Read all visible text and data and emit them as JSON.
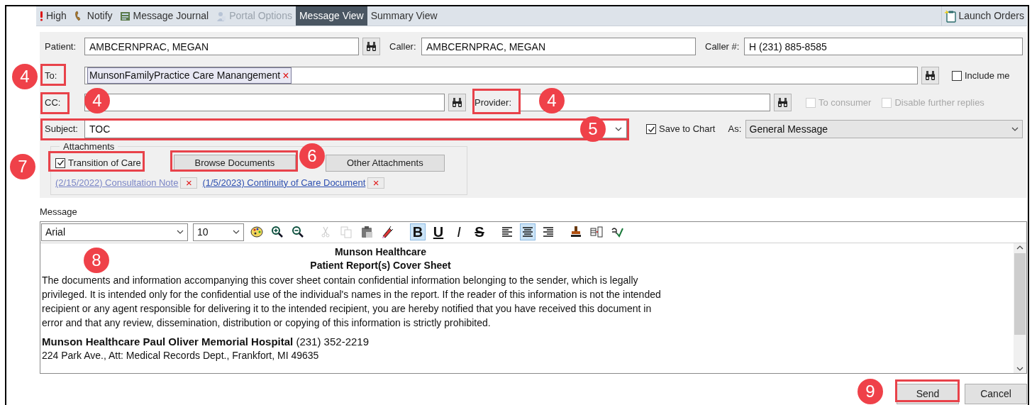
{
  "toolbar": {
    "items": [
      {
        "kind": "priority",
        "label": "High",
        "disabled": false,
        "selected": false
      },
      {
        "kind": "phone",
        "label": "Notify",
        "disabled": false,
        "selected": false
      },
      {
        "kind": "journal",
        "label": "Message Journal",
        "disabled": false,
        "selected": false
      },
      {
        "kind": "portal",
        "label": "Portal Options",
        "disabled": true,
        "selected": false
      },
      {
        "kind": "plain",
        "label": "Message View",
        "disabled": false,
        "selected": true
      },
      {
        "kind": "plain",
        "label": "Summary View",
        "disabled": false,
        "selected": false
      }
    ],
    "launch_orders": "Launch Orders"
  },
  "patient": {
    "label": "Patient:",
    "value": "AMBCERNPRAC, MEGAN"
  },
  "caller": {
    "label": "Caller:",
    "value": "AMBCERNPRAC, MEGAN"
  },
  "caller_number": {
    "label": "Caller #:",
    "value": "H (231) 885-8585"
  },
  "to": {
    "label": "To:",
    "recipients": [
      "MunsonFamilyPractice Care Manangement"
    ],
    "remove": "×"
  },
  "include_me": {
    "label": "Include me",
    "checked": false,
    "disabled": false
  },
  "cc": {
    "label": "CC:"
  },
  "provider": {
    "label": "Provider:"
  },
  "to_consumer": {
    "label": "To consumer",
    "checked": false,
    "disabled": true
  },
  "disable_replies": {
    "label": "Disable further replies",
    "checked": false,
    "disabled": true
  },
  "subject": {
    "label": "Subject:",
    "value": "TOC"
  },
  "save_to_chart": {
    "label": "Save to Chart",
    "checked": true,
    "disabled": false
  },
  "as": {
    "label": "As:",
    "value": "General Message"
  },
  "attachments": {
    "title": "Attachments",
    "transition_of_care": {
      "label": "Transition of Care",
      "checked": true,
      "disabled": false
    },
    "buttons": [
      "Browse Documents",
      "Other Attachments"
    ],
    "documents": [
      {
        "label": "(2/15/2022) Consultation Note",
        "visited": true,
        "remove": "×"
      },
      {
        "label": "(1/5/2023) Continuity of Care Document",
        "visited": false,
        "remove": "×"
      }
    ]
  },
  "message": {
    "label": "Message",
    "font": "Arial",
    "size": "10",
    "tools": [
      {
        "kind": "palette",
        "disabled": false,
        "selected": false
      },
      {
        "kind": "zoom-in",
        "disabled": false,
        "selected": false
      },
      {
        "kind": "zoom-out",
        "disabled": false,
        "selected": false
      },
      {
        "kind": "cut",
        "disabled": true,
        "selected": false
      },
      {
        "kind": "copy",
        "disabled": true,
        "selected": false
      },
      {
        "kind": "paste",
        "disabled": false,
        "selected": false
      },
      {
        "kind": "highlighter",
        "disabled": false,
        "selected": false
      },
      {
        "kind": "bold",
        "label": "B",
        "disabled": false,
        "selected": true
      },
      {
        "kind": "underline",
        "label": "U",
        "disabled": false,
        "selected": false
      },
      {
        "kind": "italic",
        "label": "I",
        "disabled": false,
        "selected": false
      },
      {
        "kind": "strike",
        "label": "S",
        "disabled": false,
        "selected": false
      },
      {
        "kind": "align-left",
        "disabled": false,
        "selected": false
      },
      {
        "kind": "align-center",
        "disabled": false,
        "selected": true
      },
      {
        "kind": "align-right",
        "disabled": false,
        "selected": false
      },
      {
        "kind": "stamp",
        "disabled": false,
        "selected": false
      },
      {
        "kind": "table",
        "disabled": false,
        "selected": false
      },
      {
        "kind": "spell",
        "disabled": false,
        "selected": false
      }
    ],
    "heading": [
      "Munson Healthcare",
      "Patient Report(s) Cover Sheet"
    ],
    "body": "The documents and information accompanying this cover sheet contain confidential information belonging to the sender, which is legally privileged.  It is intended only for the confidential use of the individual's names in the report.  If the reader of this information is not the intended recipient or any agent responsible for delivering it to the intended recipient, you are hereby notified that you have received this document in error and that any review, dissemination, distribution or copying of this information is strictly prohibited.",
    "hospital": "**Munson Healthcare Paul Oliver Memorial Hospital** (231) 352-2219",
    "address": "224 Park Ave., Att: Medical Records Dept., Frankfort, MI 49635"
  },
  "buttons": [
    "Send",
    "Cancel"
  ],
  "callouts": [
    "4",
    "4",
    "4",
    "5",
    "6",
    "7",
    "8",
    "9"
  ]
}
